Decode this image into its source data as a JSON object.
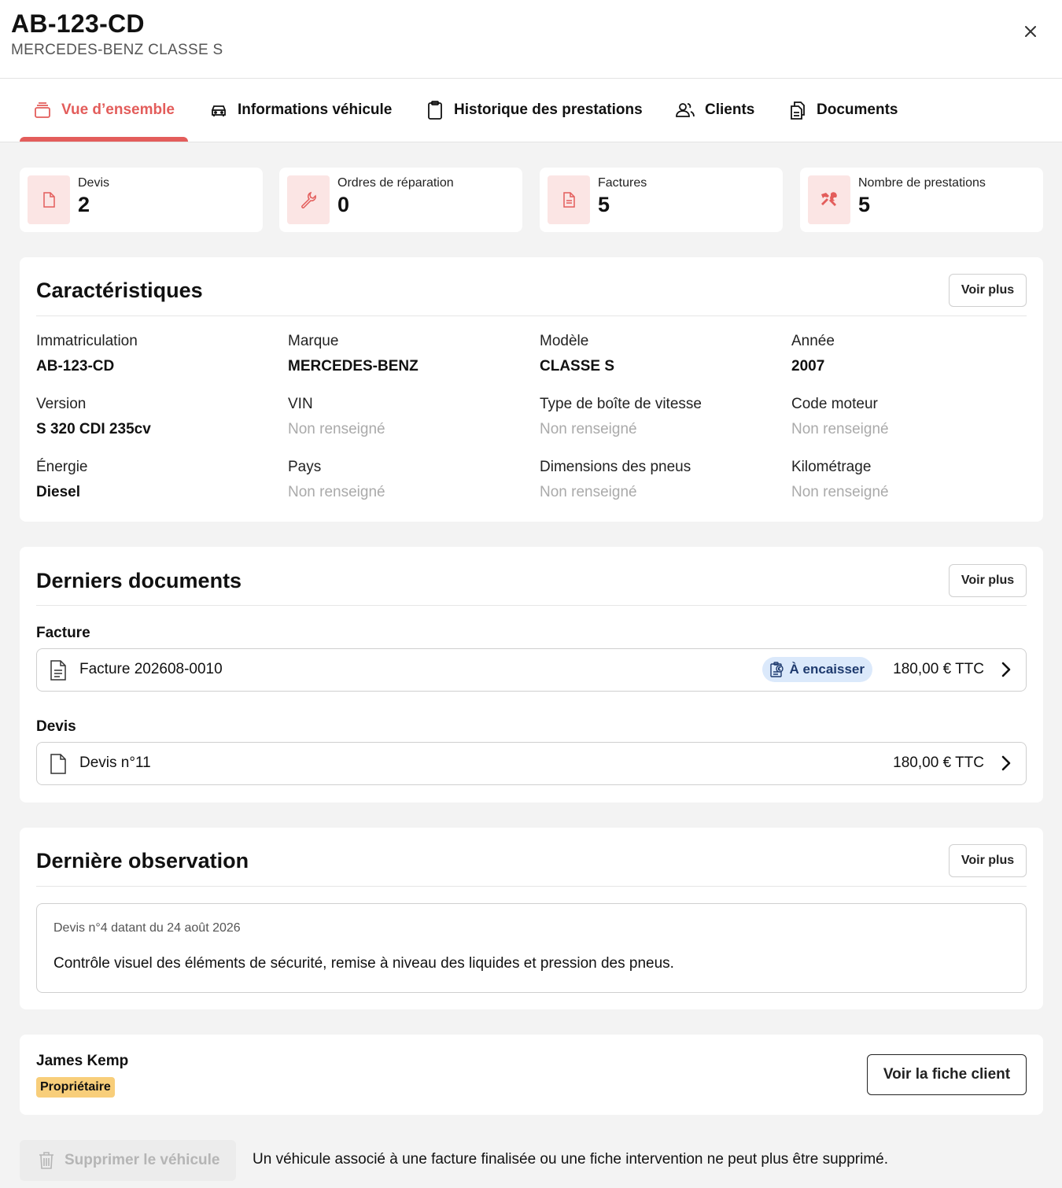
{
  "header": {
    "plate": "AB-123-CD",
    "subtitle": "MERCEDES-BENZ CLASSE S",
    "close_icon": "close-icon"
  },
  "tabs": [
    {
      "label": "Vue d’ensemble",
      "icon": "layers-icon",
      "active": true
    },
    {
      "label": "Informations véhicule",
      "icon": "car-icon",
      "active": false
    },
    {
      "label": "Historique des prestations",
      "icon": "clipboard-icon",
      "active": false
    },
    {
      "label": "Clients",
      "icon": "users-icon",
      "active": false
    },
    {
      "label": "Documents",
      "icon": "documents-icon",
      "active": false
    }
  ],
  "stats": [
    {
      "label": "Devis",
      "value": "2",
      "icon": "file-icon"
    },
    {
      "label": "Ordres de réparation",
      "value": "0",
      "icon": "wrench-icon"
    },
    {
      "label": "Factures",
      "value": "5",
      "icon": "invoice-icon"
    },
    {
      "label": "Nombre de prestations",
      "value": "5",
      "icon": "tools-icon"
    }
  ],
  "characteristics": {
    "title": "Caractéristiques",
    "more_label": "Voir plus",
    "fields": [
      {
        "label": "Immatriculation",
        "value": "AB-123-CD"
      },
      {
        "label": "Marque",
        "value": "MERCEDES-BENZ"
      },
      {
        "label": "Modèle",
        "value": "CLASSE S"
      },
      {
        "label": "Année",
        "value": "2007"
      },
      {
        "label": "Version",
        "value": "S 320 CDI 235cv"
      },
      {
        "label": "VIN",
        "value": "Non renseigné",
        "empty": true
      },
      {
        "label": "Type de boîte de vitesse",
        "value": "Non renseigné",
        "empty": true
      },
      {
        "label": "Code moteur",
        "value": "Non renseigné",
        "empty": true
      },
      {
        "label": "Énergie",
        "value": "Diesel"
      },
      {
        "label": "Pays",
        "value": "Non renseigné",
        "empty": true
      },
      {
        "label": "Dimensions des pneus",
        "value": "Non renseigné",
        "empty": true
      },
      {
        "label": "Kilométrage",
        "value": "Non renseigné",
        "empty": true
      }
    ]
  },
  "documents": {
    "title": "Derniers documents",
    "more_label": "Voir plus",
    "invoice_section": "Facture",
    "invoice": {
      "name": "Facture 202608-0010",
      "status": "À encaisser",
      "amount": "180,00 € TTC"
    },
    "quote_section": "Devis",
    "quote": {
      "name": "Devis n°11",
      "amount": "180,00 € TTC"
    }
  },
  "observation": {
    "title": "Dernière observation",
    "more_label": "Voir plus",
    "meta": "Devis n°4 datant du 24 août 2026",
    "text": "Contrôle visuel des éléments de sécurité, remise à niveau des liquides et pression des pneus."
  },
  "client": {
    "name": "James Kemp",
    "role": "Propriétaire",
    "button_label": "Voir la fiche client"
  },
  "footer": {
    "delete_label": "Supprimer le véhicule",
    "note": "Un véhicule associé à une facture finalisée ou une fiche intervention ne peut plus être supprimé."
  },
  "colors": {
    "accent": "#e35d5b",
    "accent_light": "#fbe5e4",
    "status_badge": "#dbe9fb",
    "owner_badge": "#f8ce7a",
    "muted": "#aaaaaa"
  }
}
